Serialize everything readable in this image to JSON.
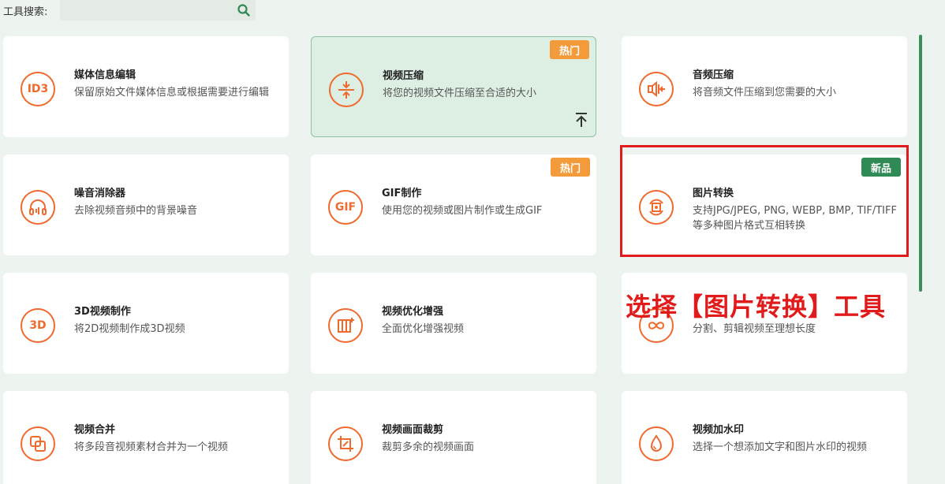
{
  "search": {
    "label": "工具搜索:",
    "placeholder": ""
  },
  "tools": [
    {
      "title": "媒体信息编辑",
      "desc": "保留原始文件媒体信息或根据需要进行编辑",
      "icon_text": "ID3",
      "icon": "id3-icon",
      "badge": ""
    },
    {
      "title": "视频压缩",
      "desc": "将您的视频文件压缩至合适的大小",
      "icon_text": "",
      "icon": "compress-icon",
      "badge": "热门"
    },
    {
      "title": "音频压缩",
      "desc": "将音频文件压缩到您需要的大小",
      "icon_text": "",
      "icon": "audio-compress-icon",
      "badge": ""
    },
    {
      "title": "噪音消除器",
      "desc": "去除视频音频中的背景噪音",
      "icon_text": "",
      "icon": "headphones-icon",
      "badge": ""
    },
    {
      "title": "GIF制作",
      "desc": "使用您的视频或图片制作或生成GIF",
      "icon_text": "GIF",
      "icon": "gif-icon",
      "badge": "热门"
    },
    {
      "title": "图片转换",
      "desc": "支持JPG/JPEG, PNG, WEBP, BMP, TIF/TIFF等多种图片格式互相转换",
      "icon_text": "",
      "icon": "image-convert-icon",
      "badge": "新品"
    },
    {
      "title": "3D视频制作",
      "desc": "将2D视频制作成3D视频",
      "icon_text": "3D",
      "icon": "3d-icon",
      "badge": ""
    },
    {
      "title": "视频优化增强",
      "desc": "全面优化增强视频",
      "icon_text": "",
      "icon": "video-enhance-icon",
      "badge": ""
    },
    {
      "title": "",
      "desc": "分割、剪辑视频至理想长度",
      "icon_text": "",
      "icon": "infinity-icon",
      "badge": ""
    },
    {
      "title": "视频合并",
      "desc": "将多段音视频素材合并为一个视频",
      "icon_text": "",
      "icon": "merge-icon",
      "badge": ""
    },
    {
      "title": "视频画面裁剪",
      "desc": "裁剪多余的视频画面",
      "icon_text": "",
      "icon": "crop-icon",
      "badge": ""
    },
    {
      "title": "视频加水印",
      "desc": "选择一个想添加文字和图片水印的视频",
      "icon_text": "",
      "icon": "watermark-icon",
      "badge": ""
    }
  ],
  "annotation": "选择【图片转换】工具",
  "colors": {
    "accent": "#ef6a2e",
    "hot_badge": "#f39b3a",
    "new_badge": "#2f8a55",
    "highlight": "#e11b1b"
  }
}
